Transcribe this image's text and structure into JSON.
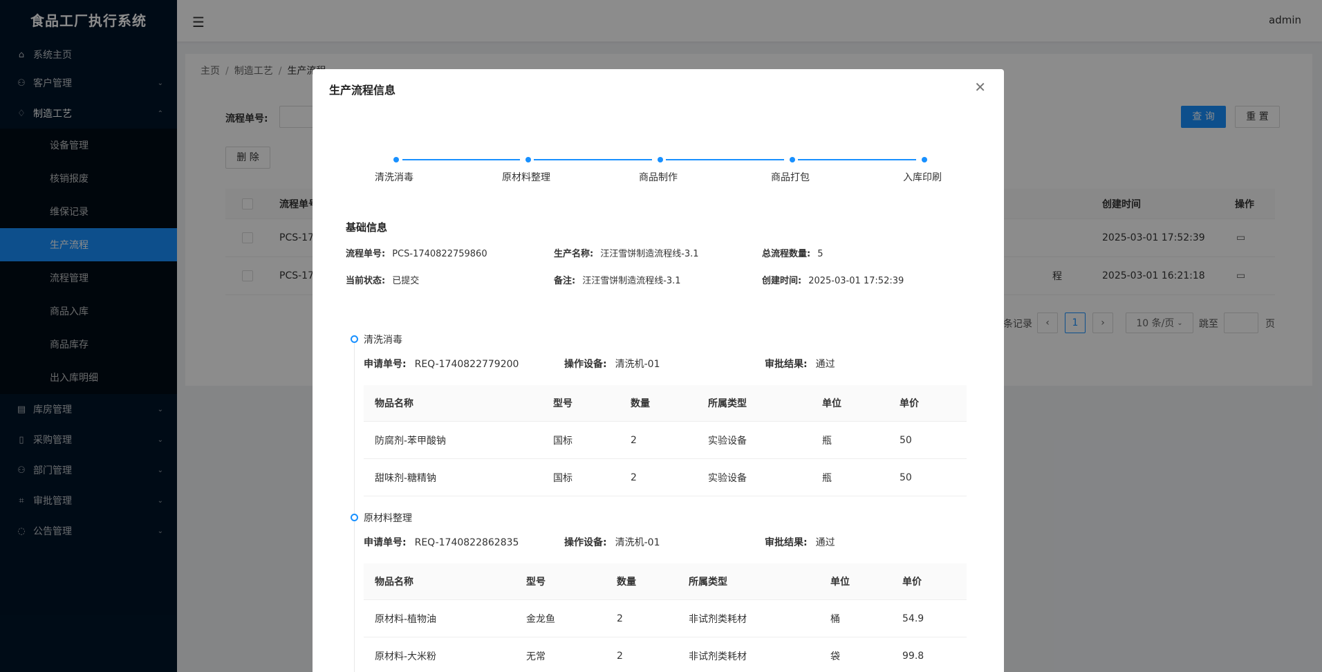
{
  "app": {
    "title": "食品工厂执行系统",
    "user": "admin"
  },
  "sidebar": {
    "items": [
      {
        "label": "系统主页",
        "icon": "home-icon"
      },
      {
        "label": "客户管理",
        "icon": "user-icon"
      },
      {
        "label": "制造工艺",
        "icon": "bulb-icon"
      },
      {
        "label": "库房管理",
        "icon": "database-icon"
      },
      {
        "label": "采购管理",
        "icon": "file-icon"
      },
      {
        "label": "部门管理",
        "icon": "user-icon"
      },
      {
        "label": "审批管理",
        "icon": "audit-icon"
      },
      {
        "label": "公告管理",
        "icon": "message-icon"
      }
    ],
    "submenu": [
      {
        "label": "设备管理"
      },
      {
        "label": "核销报废"
      },
      {
        "label": "维保记录"
      },
      {
        "label": "生产流程"
      },
      {
        "label": "流程管理"
      },
      {
        "label": "商品入库"
      },
      {
        "label": "商品库存"
      },
      {
        "label": "出入库明细"
      }
    ]
  },
  "breadcrumb": {
    "home": "主页",
    "parent": "制造工艺",
    "current": "生产流程"
  },
  "filter": {
    "label": "流程单号:",
    "search_label": "查 询",
    "reset_label": "重 置",
    "delete_label": "删 除"
  },
  "table": {
    "headers": {
      "code": "流程单号",
      "created": "创建时间",
      "action": "操作"
    },
    "rows": [
      {
        "code": "PCS-17",
        "status_tail": "",
        "created": "2025-03-01 17:52:39"
      },
      {
        "code": "PCS-17",
        "status_tail": "程",
        "created": "2025-03-01 16:21:18"
      }
    ]
  },
  "pagination": {
    "records_tail": "条记录",
    "page": "1",
    "size": "10 条/页",
    "goto": "跳至",
    "page_suffix": "页"
  },
  "modal": {
    "title": "生产流程信息",
    "steps": [
      "清洗消毒",
      "原材料整理",
      "商品制作",
      "商品打包",
      "入库印刷"
    ],
    "basic_title": "基础信息",
    "basic": {
      "code_k": "流程单号:",
      "code_v": "PCS-1740822759860",
      "name_k": "生产名称:",
      "name_v": "汪汪雪饼制造流程线-3.1",
      "total_k": "总流程数量:",
      "total_v": "5",
      "status_k": "当前状态:",
      "status_v": "已提交",
      "note_k": "备注:",
      "note_v": "汪汪雪饼制造流程线-3.1",
      "created_k": "创建时间:",
      "created_v": "2025-03-01 17:52:39"
    },
    "stages": [
      {
        "title": "清洗消毒",
        "req_k": "申请单号:",
        "req_v": "REQ-1740822779200",
        "device_k": "操作设备:",
        "device_v": "清洗机-01",
        "result_k": "审批结果:",
        "result_v": "通过",
        "headers": [
          "物品名称",
          "型号",
          "数量",
          "所属类型",
          "单位",
          "单价"
        ],
        "rows": [
          [
            "防腐剂-苯甲酸钠",
            "国标",
            "2",
            "实验设备",
            "瓶",
            "50"
          ],
          [
            "甜味剂-糖精钠",
            "国标",
            "2",
            "实验设备",
            "瓶",
            "50"
          ]
        ]
      },
      {
        "title": "原材料整理",
        "req_k": "申请单号:",
        "req_v": "REQ-1740822862835",
        "device_k": "操作设备:",
        "device_v": "清洗机-01",
        "result_k": "审批结果:",
        "result_v": "通过",
        "headers": [
          "物品名称",
          "型号",
          "数量",
          "所属类型",
          "单位",
          "单价"
        ],
        "rows": [
          [
            "原材料-植物油",
            "金龙鱼",
            "2",
            "非试剂类耗材",
            "桶",
            "54.9"
          ],
          [
            "原材料-大米粉",
            "无常",
            "2",
            "非试剂类耗材",
            "袋",
            "99.8"
          ]
        ]
      }
    ]
  },
  "colors": {
    "primary": "#1890ff",
    "sidebar": "#001529"
  }
}
